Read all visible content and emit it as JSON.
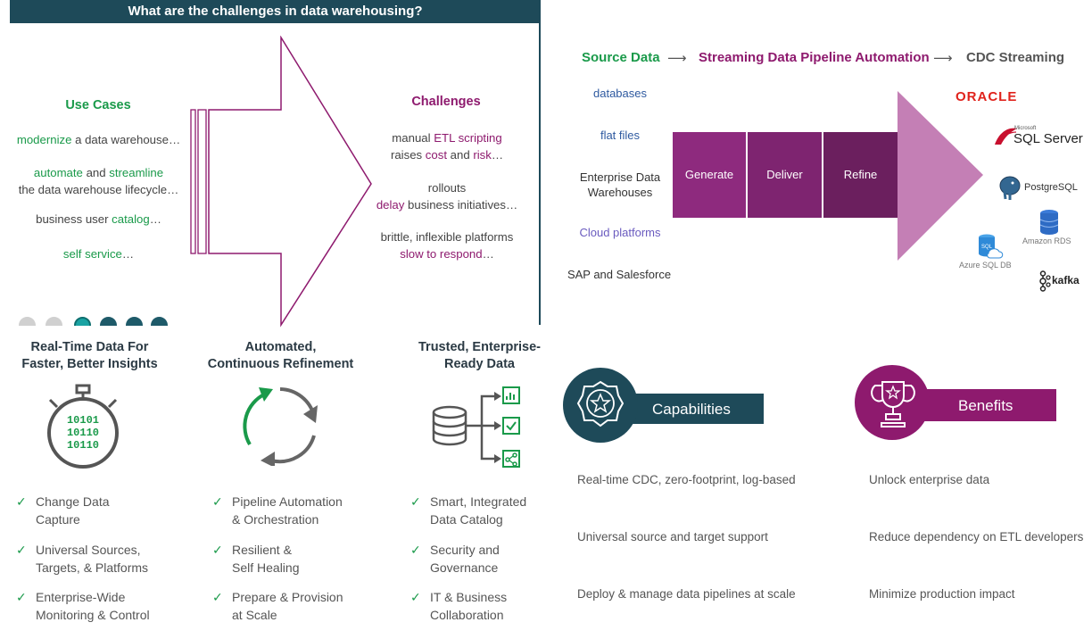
{
  "top_left": {
    "header": "What are the challenges in data warehousing?",
    "use_cases_title": "Use Cases",
    "use_cases": [
      {
        "parts": [
          {
            "t": "modernize",
            "c": "green"
          },
          {
            "t": " a data warehouse…",
            "c": "dim"
          }
        ]
      },
      {
        "parts": [
          {
            "t": "automate",
            "c": "green"
          },
          {
            "t": " and ",
            "c": "dim"
          },
          {
            "t": "streamline",
            "c": "green"
          }
        ],
        "line2": "the data warehouse lifecycle…"
      },
      {
        "parts": [
          {
            "t": "business user ",
            "c": "dim"
          },
          {
            "t": "catalog",
            "c": "green"
          },
          {
            "t": "…",
            "c": "dim"
          }
        ]
      },
      {
        "parts": [
          {
            "t": "self service",
            "c": "green"
          },
          {
            "t": "…",
            "c": "dim"
          }
        ]
      }
    ],
    "challenges_title": "Challenges",
    "challenges": [
      {
        "l1": [
          {
            "t": "manual ",
            "c": "dim"
          },
          {
            "t": "ETL scripting",
            "c": "purple"
          }
        ],
        "l2": [
          {
            "t": "raises ",
            "c": "dim"
          },
          {
            "t": "cost",
            "c": "purple"
          },
          {
            "t": " and ",
            "c": "dim"
          },
          {
            "t": "risk",
            "c": "purple"
          },
          {
            "t": "…",
            "c": "dim"
          }
        ]
      },
      {
        "l1": [
          {
            "t": "rollouts",
            "c": "dim"
          }
        ],
        "l2": [
          {
            "t": "delay",
            "c": "purple"
          },
          {
            "t": " business initiatives…",
            "c": "dim"
          }
        ]
      },
      {
        "l1": [
          {
            "t": "brittle, inflexible platforms",
            "c": "dim"
          }
        ],
        "l2": [
          {
            "t": "slow to respond",
            "c": "purple"
          },
          {
            "t": "…",
            "c": "dim"
          }
        ]
      }
    ],
    "colors": {
      "header": "#1e4a59",
      "green": "#1a9a4a",
      "purple": "#8e1a6e"
    }
  },
  "top_right": {
    "heading": {
      "source": "Source Data",
      "pipeline": "Streaming Data Pipeline Automation",
      "cdc": "CDC Streaming",
      "arrow": "⟶"
    },
    "sources": [
      "databases",
      "flat files",
      "Enterprise Data\nWarehouses",
      "Cloud platforms",
      "SAP and Salesforce"
    ],
    "stages": [
      "Generate",
      "Deliver",
      "Refine"
    ],
    "targets": {
      "oracle": "ORACLE",
      "sqlserver_small": "Microsoft",
      "sqlserver": "SQL Server",
      "postgres": "PostgreSQL",
      "amazon_rds": "Amazon RDS",
      "azure_sql_icon": "SQL",
      "azure_sql": "Azure SQL DB",
      "kafka": "kafka"
    },
    "colors": {
      "stage1": "#8e2a7e",
      "stage2": "#7e2470",
      "stage3": "#6b1f5e",
      "arrow": "#c47fb5"
    }
  },
  "bottom_left": {
    "columns": [
      {
        "title": "Real-Time Data For\nFaster, Better Insights",
        "icon": "stopwatch-icon",
        "binary": [
          "10101",
          "10110",
          "10110"
        ],
        "items": [
          "Change Data\nCapture",
          "Universal Sources,\nTargets, & Platforms",
          "Enterprise-Wide\nMonitoring & Control"
        ]
      },
      {
        "title": "Automated,\nContinuous Refinement",
        "icon": "refresh-cycle-icon",
        "items": [
          "Pipeline Automation\n& Orchestration",
          "Resilient &\nSelf Healing",
          "Prepare & Provision\nat Scale"
        ]
      },
      {
        "title": "Trusted, Enterprise-\nReady Data",
        "icon": "database-catalog-icon",
        "items": [
          "Smart, Integrated\nData Catalog",
          "Security and\nGovernance",
          "IT & Business\nCollaboration"
        ]
      }
    ],
    "check_glyph": "✓"
  },
  "bottom_right": {
    "capabilities_title": "Capabilities",
    "benefits_title": "Benefits",
    "capabilities": [
      "Real-time CDC, zero-footprint, log-based",
      "Universal source and target support",
      "Deploy & manage data pipelines at scale"
    ],
    "benefits": [
      "Unlock enterprise data",
      "Reduce dependency on ETL developers",
      "Minimize production impact"
    ],
    "colors": {
      "capabilities": "#1e4a59",
      "benefits": "#8e1a6e"
    }
  }
}
